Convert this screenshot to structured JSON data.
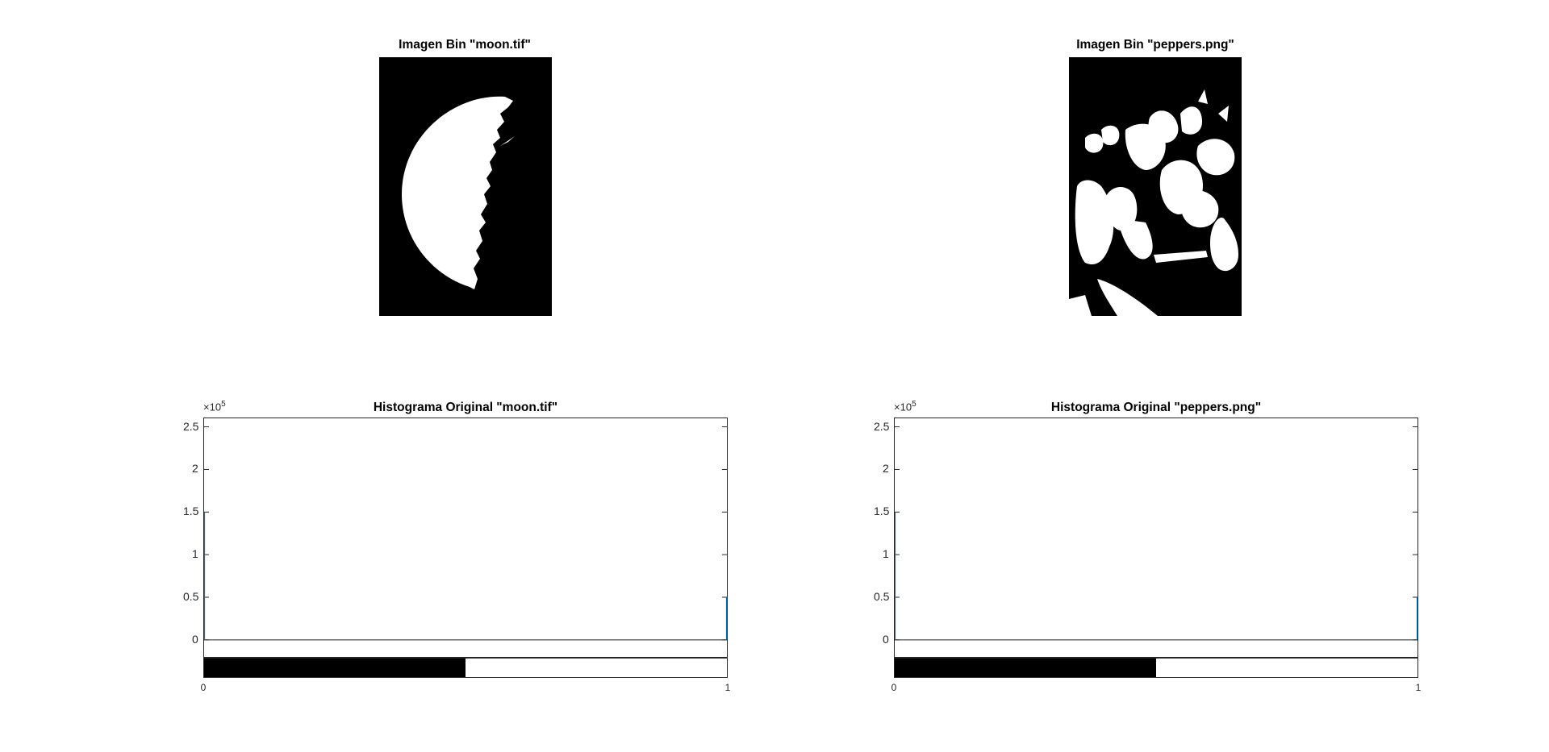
{
  "images": [
    {
      "title": "Imagen Bin \"moon.tif\""
    },
    {
      "title": "Imagen Bin \"peppers.png\""
    }
  ],
  "chart_data": [
    {
      "type": "bar",
      "title": "Histograma Original \"moon.tif\"",
      "xlabel": "",
      "ylabel": "",
      "x": [
        0,
        1
      ],
      "values": [
        150000,
        50000
      ],
      "xlim": [
        0,
        1
      ],
      "ylim": [
        -20000,
        260000
      ],
      "yticks": [
        0,
        0.5,
        1,
        1.5,
        2,
        2.5
      ],
      "ytick_labels": [
        "0",
        "0.5",
        "1",
        "1.5",
        "2",
        "2.5"
      ],
      "xtick_labels": [
        "0",
        "1"
      ],
      "exponent": "×10",
      "exponent_power": "5",
      "bar_color": "#0072BD",
      "colorbar_split": 0.5,
      "grid": false
    },
    {
      "type": "bar",
      "title": "Histograma Original \"peppers.png\"",
      "xlabel": "",
      "ylabel": "",
      "x": [
        0,
        1
      ],
      "values": [
        150000,
        50000
      ],
      "xlim": [
        0,
        1
      ],
      "ylim": [
        -20000,
        260000
      ],
      "yticks": [
        0,
        0.5,
        1,
        1.5,
        2,
        2.5
      ],
      "ytick_labels": [
        "0",
        "0.5",
        "1",
        "1.5",
        "2",
        "2.5"
      ],
      "xtick_labels": [
        "0",
        "1"
      ],
      "exponent": "×10",
      "exponent_power": "5",
      "bar_color": "#0072BD",
      "colorbar_split": 0.5,
      "grid": false
    }
  ]
}
